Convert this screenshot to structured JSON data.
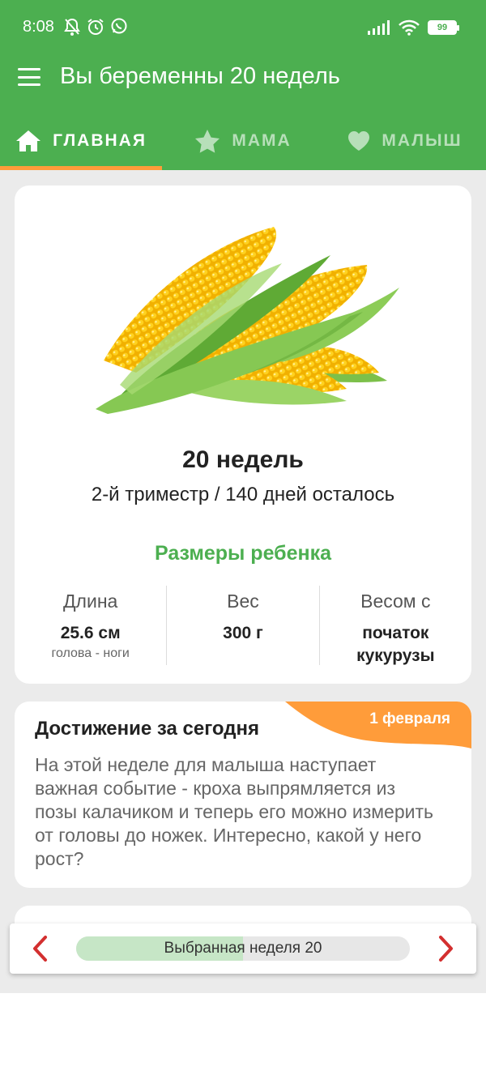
{
  "status_bar": {
    "time": "8:08",
    "battery": "99"
  },
  "toolbar": {
    "title": "Вы беременны 20 недель"
  },
  "tabs": [
    {
      "label": "ГЛАВНАЯ",
      "icon": "home-icon",
      "active": true
    },
    {
      "label": "МАМА",
      "icon": "star-icon",
      "active": false
    },
    {
      "label": "МАЛЫШ",
      "icon": "heart-icon",
      "active": false
    }
  ],
  "week_card": {
    "image": "corn-image",
    "title": "20 недель",
    "subtitle": "2-й триместр / 140 дней осталось",
    "sizes_heading": "Размеры ребенка",
    "stats": [
      {
        "label": "Длина",
        "value": "25.6 см",
        "sub": "голова - ноги"
      },
      {
        "label": "Вес",
        "value": "300 г",
        "sub": ""
      },
      {
        "label": "Весом с",
        "value": "початок кукурузы",
        "sub": ""
      }
    ]
  },
  "achievement": {
    "date": "1 февраля",
    "title": "Достижение за сегодня",
    "text": "На этой неделе для малыша наступает важная событие - кроха выпрямляется из позы калачиком и теперь его можно измерить от головы до ножек. Интересно, какой у него рост?"
  },
  "week_selector": {
    "label": "Выбранная неделя 20",
    "progress": 0.5
  },
  "colors": {
    "primary": "#4caf50",
    "accent": "#ff9c3a",
    "background": "#ebebeb",
    "arrow": "#d32f2f"
  }
}
